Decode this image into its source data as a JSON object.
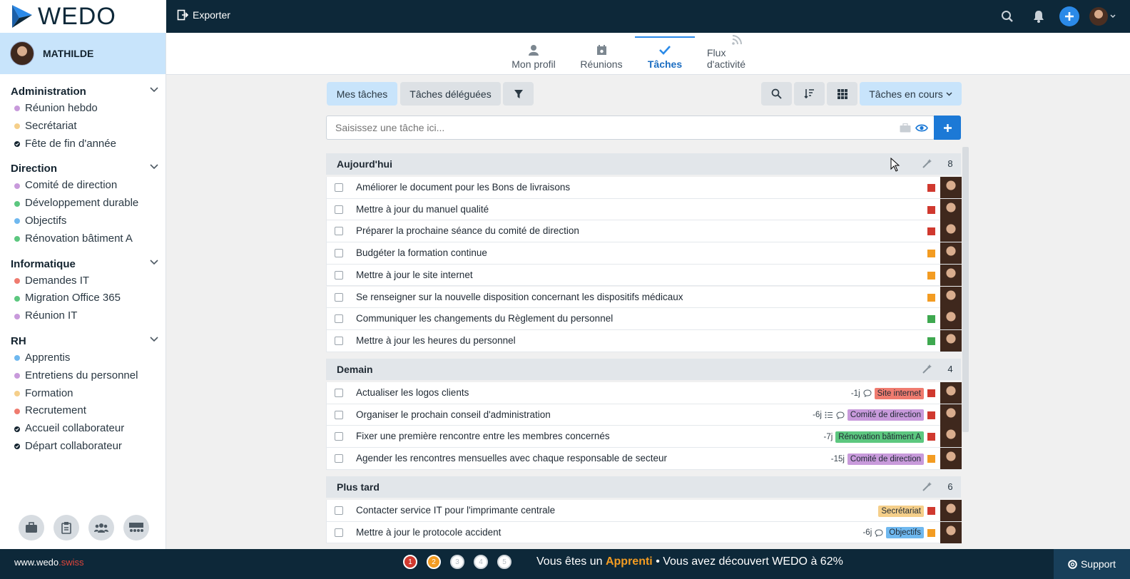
{
  "app": {
    "logo_text": "WEDO"
  },
  "topbar": {
    "export_label": "Exporter"
  },
  "user": {
    "name": "MATHILDE"
  },
  "sidebar": {
    "sections": [
      {
        "title": "Administration",
        "items": [
          {
            "label": "Réunion hebdo",
            "color": "#c89adb",
            "done": false
          },
          {
            "label": "Secrétariat",
            "color": "#f5cf8a",
            "done": false
          },
          {
            "label": "Fête de fin d'année",
            "color": "#13232f",
            "done": true
          }
        ]
      },
      {
        "title": "Direction",
        "items": [
          {
            "label": "Comité de direction",
            "color": "#c89adb",
            "done": false
          },
          {
            "label": "Développement durable",
            "color": "#5cc77f",
            "done": false
          },
          {
            "label": "Objectifs",
            "color": "#6fb8ef",
            "done": false
          },
          {
            "label": "Rénovation bâtiment A",
            "color": "#5cc77f",
            "done": false
          }
        ]
      },
      {
        "title": "Informatique",
        "items": [
          {
            "label": "Demandes IT",
            "color": "#ef7b6f",
            "done": false
          },
          {
            "label": "Migration Office 365",
            "color": "#5cc77f",
            "done": false
          },
          {
            "label": "Réunion IT",
            "color": "#c89adb",
            "done": false
          }
        ]
      },
      {
        "title": "RH",
        "items": [
          {
            "label": "Apprentis",
            "color": "#6fb8ef",
            "done": false
          },
          {
            "label": "Entretiens du personnel",
            "color": "#c89adb",
            "done": false
          },
          {
            "label": "Formation",
            "color": "#f5cf8a",
            "done": false
          },
          {
            "label": "Recrutement",
            "color": "#ef7b6f",
            "done": false
          },
          {
            "label": "Accueil collaborateur",
            "color": "#13232f",
            "done": true
          },
          {
            "label": "Départ collaborateur",
            "color": "#13232f",
            "done": true
          }
        ]
      }
    ]
  },
  "tabs": [
    {
      "label": "Mon profil",
      "icon": "user-icon",
      "active": false
    },
    {
      "label": "Réunions",
      "icon": "calendar-icon",
      "active": false
    },
    {
      "label": "Tâches",
      "icon": "check-icon",
      "active": true
    },
    {
      "label": "Flux d'activité",
      "icon": "rss-icon",
      "active": false
    }
  ],
  "toolbar": {
    "my_tasks": "Mes tâches",
    "delegated": "Tâches déléguées",
    "filter_status": "Tâches en cours"
  },
  "task_input": {
    "placeholder": "Saisissez une tâche ici..."
  },
  "groups": [
    {
      "title": "Aujourd'hui",
      "count": "8",
      "tasks": [
        {
          "title": "Améliorer le document pour les Bons de livraisons",
          "priority": "#d0392f"
        },
        {
          "title": "Mettre à jour du manuel qualité",
          "priority": "#d0392f"
        },
        {
          "title": "Préparer la prochaine séance du comité de direction",
          "priority": "#d0392f"
        },
        {
          "title": "Budgéter la formation continue",
          "priority": "#f39c22"
        },
        {
          "title": "Mettre à jour le site internet",
          "priority": "#f39c22"
        },
        {
          "title": "Se renseigner sur la nouvelle disposition concernant les dispositifs médicaux",
          "priority": "#f39c22"
        },
        {
          "title": "Communiquer les changements du Règlement du personnel",
          "priority": "#3ea84f"
        },
        {
          "title": "Mettre à jour les heures du personnel",
          "priority": "#3ea84f"
        }
      ]
    },
    {
      "title": "Demain",
      "count": "4",
      "tasks": [
        {
          "title": "Actualiser les logos clients",
          "priority": "#d0392f",
          "delay": "-1j",
          "icons": [
            "comment-icon"
          ],
          "tag": "Site internet",
          "tag_color": "#ef7b6f"
        },
        {
          "title": "Organiser le prochain conseil d'administration",
          "priority": "#d0392f",
          "delay": "-6j",
          "icons": [
            "list-icon",
            "comment-icon"
          ],
          "tag": "Comité de direction",
          "tag_color": "#c89adb"
        },
        {
          "title": "Fixer une première rencontre entre les membres concernés",
          "priority": "#d0392f",
          "delay": "-7j",
          "icons": [],
          "tag": "Rénovation bâtiment A",
          "tag_color": "#5cc77f"
        },
        {
          "title": "Agender les rencontres mensuelles avec chaque responsable de secteur",
          "priority": "#f39c22",
          "delay": "-15j",
          "icons": [],
          "tag": "Comité de direction",
          "tag_color": "#c89adb"
        }
      ]
    },
    {
      "title": "Plus tard",
      "count": "6",
      "tasks": [
        {
          "title": "Contacter service IT pour l'imprimante centrale",
          "priority": "#d0392f",
          "delay": "",
          "icons": [],
          "tag": "Secrétariat",
          "tag_color": "#f5cf8a"
        },
        {
          "title": "Mettre à jour le protocole accident",
          "priority": "#f39c22",
          "delay": "-6j",
          "icons": [
            "comment-icon"
          ],
          "tag": "Objectifs",
          "tag_color": "#6fb8ef"
        }
      ]
    }
  ],
  "footer": {
    "site_prefix": "www.wedo",
    "site_suffix": ".swiss",
    "steps": [
      {
        "number": "1",
        "color": "#d0392f"
      },
      {
        "number": "2",
        "color": "#f39c22"
      },
      {
        "number": "3",
        "color": "#ffffff"
      },
      {
        "number": "4",
        "color": "#ffffff"
      },
      {
        "number": "5",
        "color": "#ffffff"
      }
    ],
    "msg_prefix": "Vous êtes un ",
    "level": "Apprenti",
    "msg_suffix": " • Vous avez découvert WEDO à 62%",
    "support_label": "Support"
  }
}
